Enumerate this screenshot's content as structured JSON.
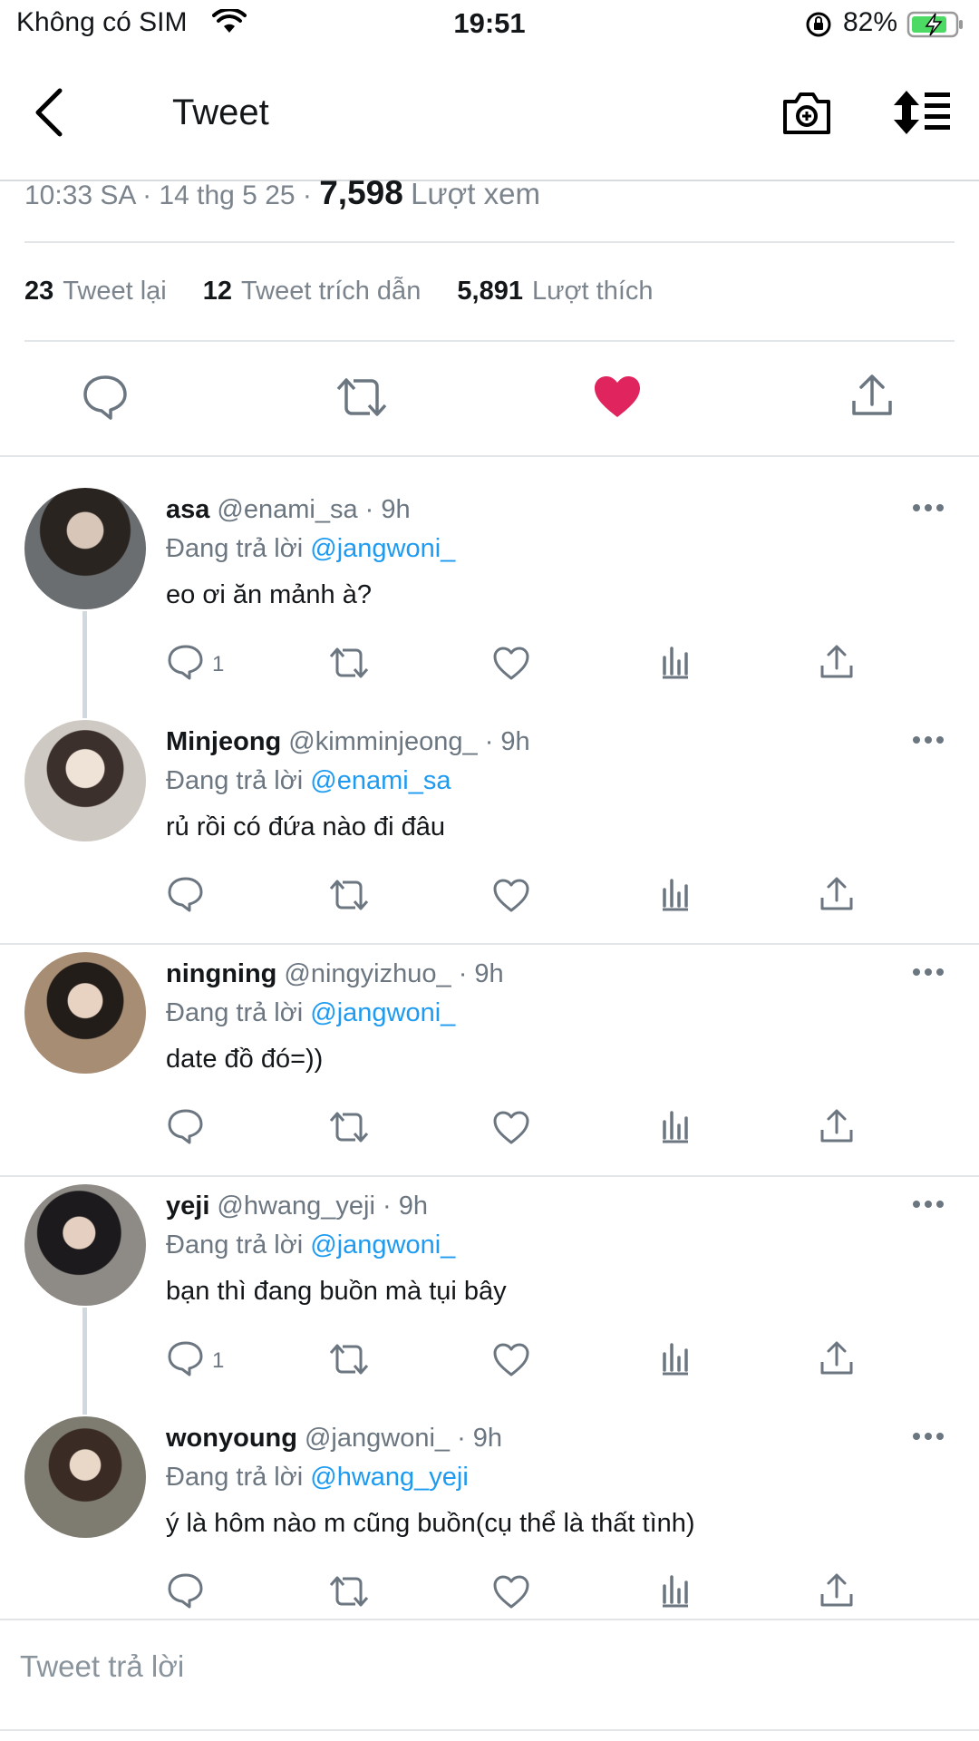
{
  "status_bar": {
    "carrier": "Không có SIM",
    "time": "19:51",
    "battery_pct": "82%"
  },
  "nav": {
    "title": "Tweet",
    "back_icon": "chevron-left-icon",
    "camera_icon": "camera-add-icon",
    "sort_icon": "sort-icon"
  },
  "tweet": {
    "time_date": "10:33 SA · 14 thg 5 25 ·",
    "views_count": "7,598",
    "views_label": "Lượt xem",
    "retweets_count": "23",
    "retweets_label": "Tweet lại",
    "quotes_count": "12",
    "quotes_label": "Tweet trích dẫn",
    "likes_count": "5,891",
    "likes_label": "Lượt thích",
    "liked": true,
    "like_color": "#e0245e"
  },
  "replies": [
    {
      "name": "asa",
      "handle": "@enami_sa",
      "time": "· 9h",
      "replying_prefix": "Đang trả lời",
      "replying_to": "@jangwoni_",
      "text": "eo ơi ăn mảnh à?",
      "reply_count": "1"
    },
    {
      "name": "Minjeong",
      "handle": "@kimminjeong_",
      "time": "· 9h",
      "replying_prefix": "Đang trả lời",
      "replying_to": "@enami_sa",
      "text": "rủ rồi có đứa nào đi đâu",
      "reply_count": ""
    },
    {
      "name": "ningning",
      "handle": "@ningyizhuo_",
      "time": "· 9h",
      "replying_prefix": "Đang trả lời",
      "replying_to": "@jangwoni_",
      "text": "date đồ đó=))",
      "reply_count": ""
    },
    {
      "name": "yeji",
      "handle": "@hwang_yeji",
      "time": "· 9h",
      "replying_prefix": "Đang trả lời",
      "replying_to": "@jangwoni_",
      "text": "bạn thì đang buồn mà tụi bây",
      "reply_count": "1"
    },
    {
      "name": "wonyoung",
      "handle": "@jangwoni_",
      "time": "· 9h",
      "replying_prefix": "Đang trả lời",
      "replying_to": "@hwang_yeji",
      "text": "ý là hôm nào m cũng buồn(cụ thể là thất tình)",
      "reply_count": ""
    }
  ],
  "compose": {
    "placeholder": "Tweet trả lời"
  },
  "colors": {
    "accent": "#1d9bf0",
    "like": "#e0245e",
    "battery": "#4cd964"
  }
}
